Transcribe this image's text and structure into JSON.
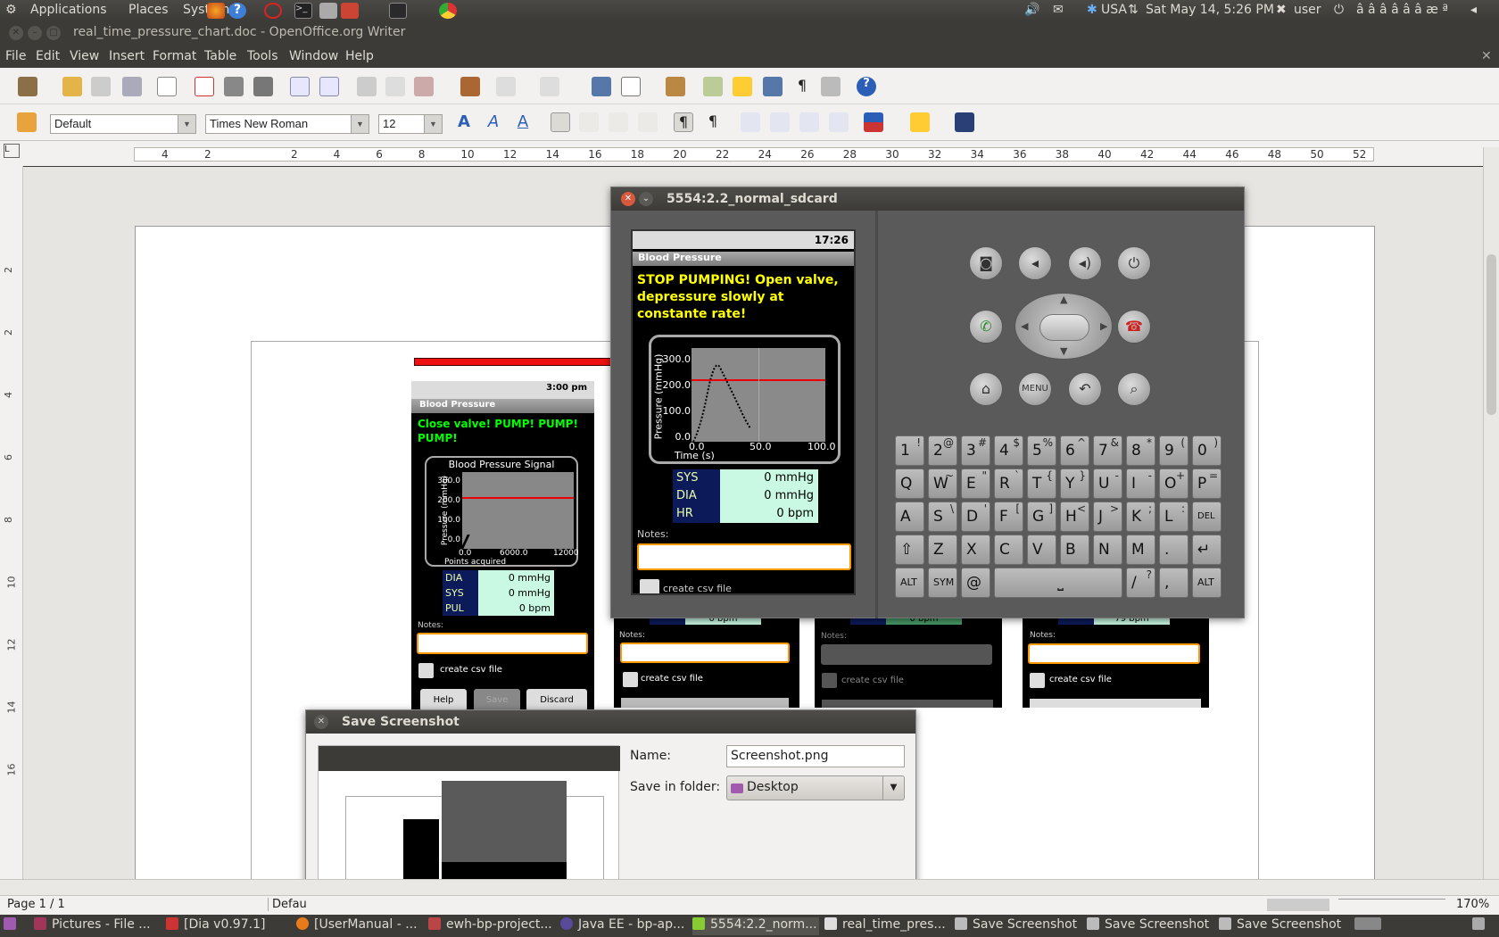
{
  "top_panel": {
    "menus": [
      "Applications",
      "Places",
      "System"
    ],
    "kbd": "USA",
    "datetime": "Sat May 14,  5:26 PM",
    "user": "user",
    "extra": "â â â â â â æ ª"
  },
  "window": {
    "title": "real_time_pressure_chart.doc - OpenOffice.org Writer"
  },
  "menubar": [
    "File",
    "Edit",
    "View",
    "Insert",
    "Format",
    "Table",
    "Tools",
    "Window",
    "Help"
  ],
  "format_bar": {
    "style": "Default",
    "font": "Times New Roman",
    "size": "12"
  },
  "ruler": {
    "h": [
      "4",
      "2",
      "2",
      "4",
      "6",
      "8",
      "10",
      "12",
      "14",
      "16",
      "18",
      "20",
      "22",
      "24",
      "26",
      "28",
      "30",
      "32",
      "34",
      "36",
      "38",
      "40",
      "42",
      "44",
      "46",
      "48",
      "50",
      "52"
    ],
    "v": [
      "2",
      "2",
      "4",
      "6",
      "8",
      "10",
      "12",
      "14",
      "16"
    ]
  },
  "phone_left": {
    "time": "3:00 pm",
    "title": "Blood Pressure",
    "message": "Close valve! PUMP! PUMP! PUMP!",
    "chart": {
      "title": "Blood Pressure Signal",
      "ylabel": "Pressure (mmHg)",
      "xlabel": "Points acquired",
      "yticks": [
        "300.0",
        "200.0",
        "100.0",
        "0.0"
      ],
      "xticks": [
        "0.0",
        "6000.0",
        "12000"
      ]
    },
    "readings": [
      {
        "label": "DIA",
        "value": "0 mmHg"
      },
      {
        "label": "SYS",
        "value": "0 mmHg"
      },
      {
        "label": "PUL",
        "value": "0 bpm"
      }
    ],
    "notes_label": "Notes:",
    "csv_label": "create csv file",
    "buttons": [
      "Help",
      "Save",
      "Discard"
    ]
  },
  "phone_mid": {
    "notes_label": "Notes:",
    "csv_label": "create csv file",
    "pul": "0 bpm"
  },
  "phone_mid2": {
    "notes_label": "Notes:",
    "csv_label": "create csv file",
    "pul": "0 bpm"
  },
  "phone_right": {
    "notes_label": "Notes:",
    "csv_label": "create csv file",
    "pul": "79 bpm"
  },
  "emulator": {
    "title": "5554:2.2_normal_sdcard",
    "time": "17:26",
    "app_title": "Blood Pressure",
    "message": "STOP PUMPING! Open valve, depressure slowly at constante rate!",
    "chart": {
      "ylabel": "Pressure (mmHg)",
      "xlabel": "Time (s)",
      "yticks": [
        "300.0",
        "200.0",
        "100.0",
        "0.0"
      ],
      "xticks": [
        "0.0",
        "50.0",
        "100.0"
      ]
    },
    "readings": [
      {
        "label": "SYS",
        "value": "0 mmHg"
      },
      {
        "label": "DIA",
        "value": "0 mmHg"
      },
      {
        "label": "HR",
        "value": "0 bpm"
      }
    ],
    "notes_label": "Notes:",
    "csv_label": "create csv file",
    "menu_label": "MENU",
    "keyboard": {
      "row1": [
        [
          "1",
          "!"
        ],
        [
          "2",
          "@"
        ],
        [
          "3",
          "#"
        ],
        [
          "4",
          "$"
        ],
        [
          "5",
          "%"
        ],
        [
          "6",
          "^"
        ],
        [
          "7",
          "&"
        ],
        [
          "8",
          "*"
        ],
        [
          "9",
          "("
        ],
        [
          "0",
          ")"
        ]
      ],
      "row2": [
        [
          "Q",
          ""
        ],
        [
          "W",
          "~"
        ],
        [
          "E",
          "\""
        ],
        [
          "R",
          "`"
        ],
        [
          "T",
          "{"
        ],
        [
          "Y",
          "}"
        ],
        [
          "U",
          "-"
        ],
        [
          "I",
          "-"
        ],
        [
          "O",
          "+"
        ],
        [
          "P",
          "="
        ]
      ],
      "row3": [
        [
          "A",
          ""
        ],
        [
          "S",
          "\\"
        ],
        [
          "D",
          "'"
        ],
        [
          "F",
          "["
        ],
        [
          "G",
          "]"
        ],
        [
          "H",
          "<"
        ],
        [
          "J",
          ">"
        ],
        [
          "K",
          ";"
        ],
        [
          "L",
          ":"
        ],
        [
          "DEL",
          ""
        ]
      ],
      "row4": [
        "⇧",
        "Z",
        "X",
        "C",
        "V",
        "B",
        "N",
        "M",
        ".",
        "↵"
      ],
      "row5": [
        "ALT",
        "SYM",
        "@",
        "⎵",
        "/",
        "?",
        ",",
        "ALT"
      ]
    }
  },
  "save_dialog": {
    "title": "Save Screenshot",
    "name_label": "Name:",
    "name_value": "Screenshot.png",
    "folder_label": "Save in folder:",
    "folder_value": "Desktop"
  },
  "statusbar": {
    "page": "Page 1 / 1",
    "style": "Defau",
    "zoom": "170%"
  },
  "taskbar": [
    "Pictures - File ...",
    "[Dia v0.97.1]",
    "[UserManual - ...",
    "ewh-bp-project...",
    "Java EE - bp-ap...",
    "5554:2.2_norm...",
    "real_time_pres...",
    "Save Screenshot",
    "Save Screenshot",
    "Save Screenshot"
  ]
}
